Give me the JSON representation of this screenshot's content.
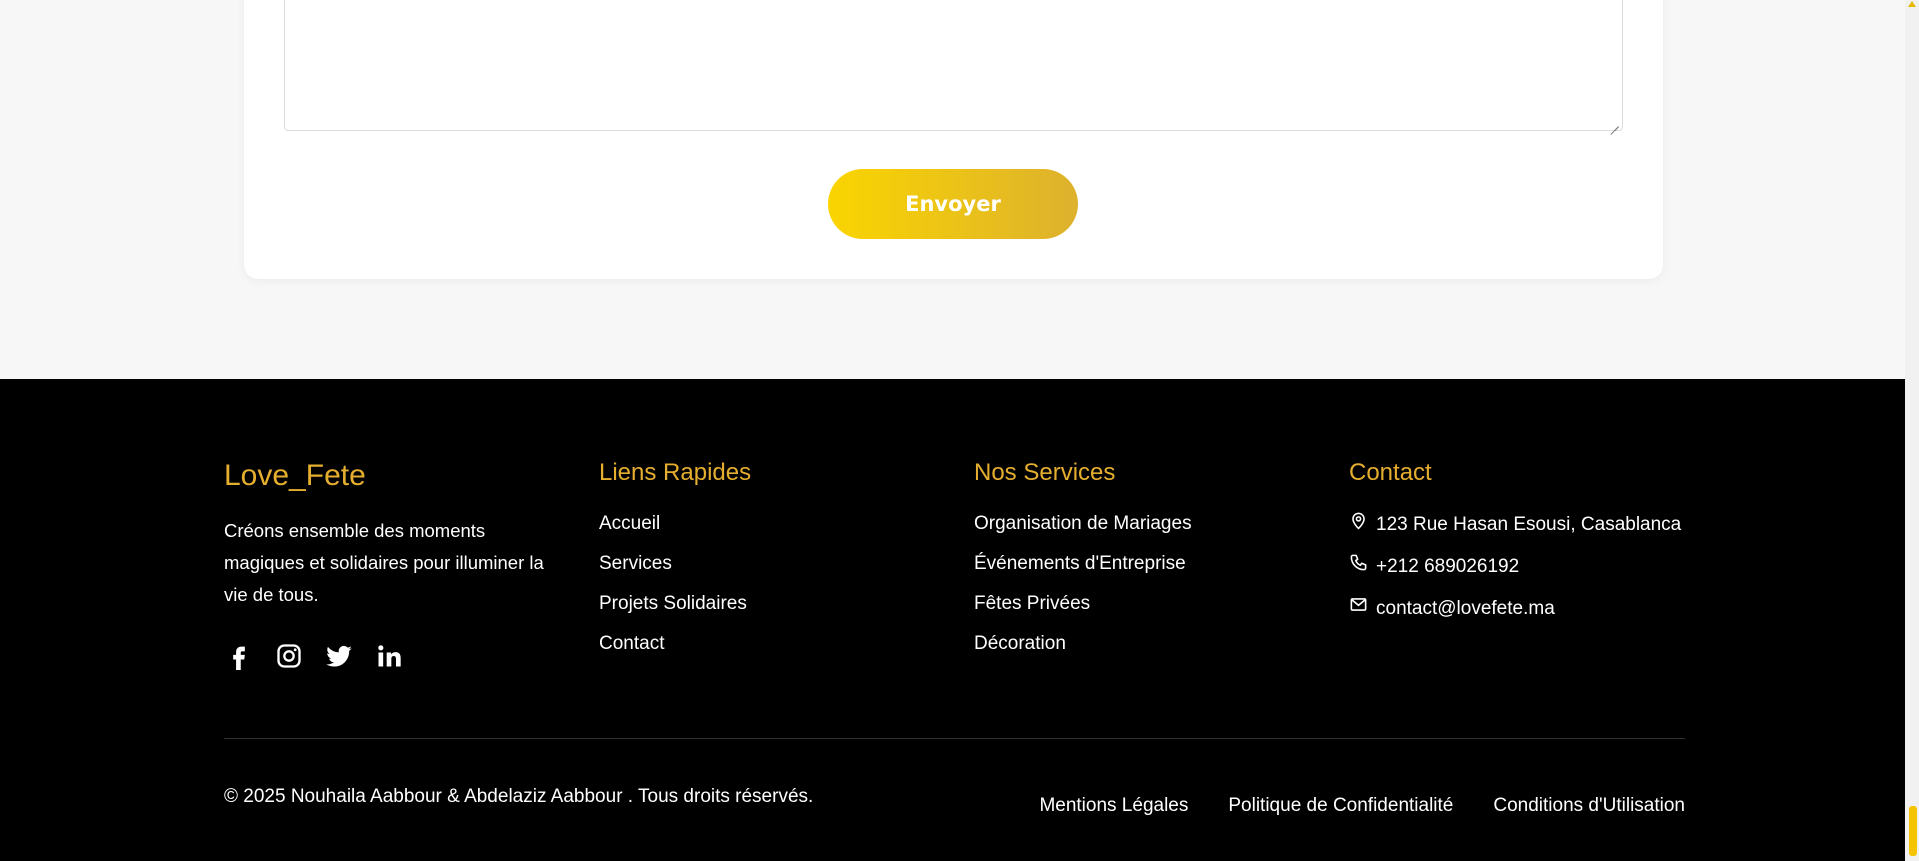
{
  "form": {
    "message": "",
    "submit_label": "Envoyer"
  },
  "footer": {
    "brand": "Love_Fete",
    "about": "Créons ensemble des moments magiques et solidaires pour illuminer la vie de tous.",
    "socials": [
      "facebook-icon",
      "instagram-icon",
      "twitter-icon",
      "linkedin-icon"
    ],
    "quick_links": {
      "title": "Liens Rapides",
      "items": [
        "Accueil",
        "Services",
        "Projets Solidaires",
        "Contact"
      ]
    },
    "services": {
      "title": "Nos Services",
      "items": [
        "Organisation de Mariages",
        "Événements d'Entreprise",
        "Fêtes Privées",
        "Décoration"
      ]
    },
    "contact": {
      "title": "Contact",
      "address": "123 Rue Hasan Esousi, Casablanca",
      "phone": "+212 689026192",
      "email": "contact@lovefete.ma"
    },
    "copyright": "© 2025 Nouhaila Aabbour & Abdelaziz Aabbour . Tous droits réservés.",
    "legal": [
      "Mentions Légales",
      "Politique de Confidentialité",
      "Conditions d'Utilisation"
    ]
  },
  "colors": {
    "accent": "#e5ae2f",
    "button_gradient_start": "#fad500",
    "button_gradient_end": "#ddb12e",
    "footer_bg": "#000000",
    "page_bg": "#f7f7f7"
  }
}
